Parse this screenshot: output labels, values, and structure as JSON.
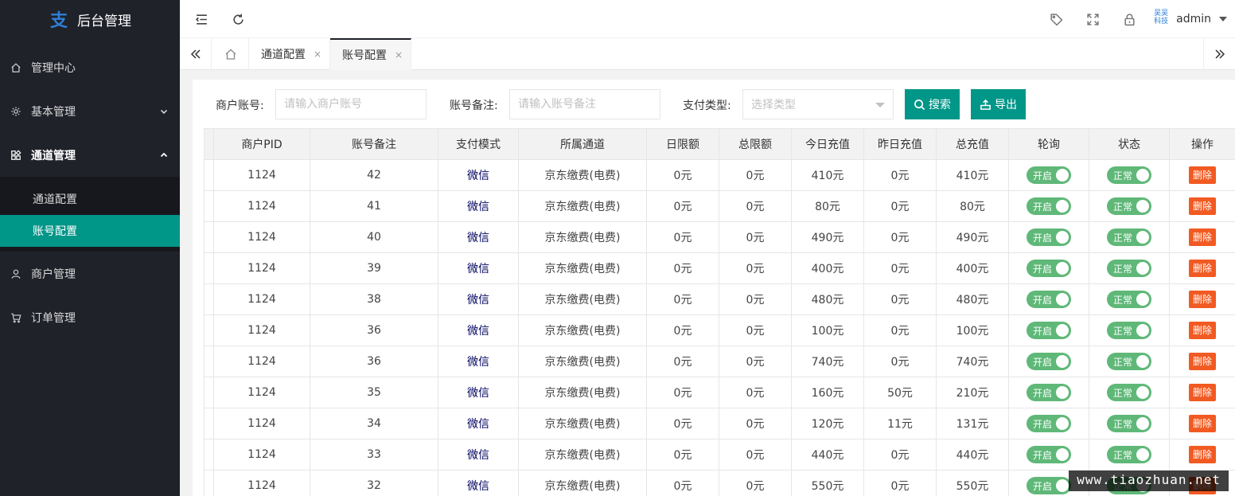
{
  "app": {
    "title": "后台管理"
  },
  "sidebar": {
    "items": [
      {
        "label": "管理中心"
      },
      {
        "label": "基本管理"
      },
      {
        "label": "通道管理"
      },
      {
        "label": "商户管理"
      },
      {
        "label": "订单管理"
      }
    ],
    "sub_items": [
      {
        "label": "通道配置"
      },
      {
        "label": "账号配置"
      }
    ]
  },
  "header": {
    "user": "admin",
    "avatar_text_1": "吴吴",
    "avatar_text_2": "科技"
  },
  "tabs": {
    "t1": "通道配置",
    "t2": "账号配置",
    "close": "×"
  },
  "filters": {
    "merchant_label": "商户账号:",
    "merchant_placeholder": "请输入商户账号",
    "remark_label": "账号备注:",
    "remark_placeholder": "请输入账号备注",
    "paytype_label": "支付类型:",
    "paytype_placeholder": "选择类型",
    "search_label": "搜索",
    "export_label": "导出"
  },
  "table": {
    "headers": [
      "商户PID",
      "账号备注",
      "支付模式",
      "所属通道",
      "日限额",
      "总限额",
      "今日充值",
      "昨日充值",
      "总充值",
      "轮询",
      "状态",
      "操作"
    ],
    "rows": [
      [
        "1124",
        "42",
        "微信",
        "京东缴费(电费)",
        "0元",
        "0元",
        "410元",
        "0元",
        "410元",
        "开启",
        "正常",
        "删除"
      ],
      [
        "1124",
        "41",
        "微信",
        "京东缴费(电费)",
        "0元",
        "0元",
        "80元",
        "0元",
        "80元",
        "开启",
        "正常",
        "删除"
      ],
      [
        "1124",
        "40",
        "微信",
        "京东缴费(电费)",
        "0元",
        "0元",
        "490元",
        "0元",
        "490元",
        "开启",
        "正常",
        "删除"
      ],
      [
        "1124",
        "39",
        "微信",
        "京东缴费(电费)",
        "0元",
        "0元",
        "400元",
        "0元",
        "400元",
        "开启",
        "正常",
        "删除"
      ],
      [
        "1124",
        "38",
        "微信",
        "京东缴费(电费)",
        "0元",
        "0元",
        "480元",
        "0元",
        "480元",
        "开启",
        "正常",
        "删除"
      ],
      [
        "1124",
        "36",
        "微信",
        "京东缴费(电费)",
        "0元",
        "0元",
        "100元",
        "0元",
        "100元",
        "开启",
        "正常",
        "删除"
      ],
      [
        "1124",
        "36",
        "微信",
        "京东缴费(电费)",
        "0元",
        "0元",
        "740元",
        "0元",
        "740元",
        "开启",
        "正常",
        "删除"
      ],
      [
        "1124",
        "35",
        "微信",
        "京东缴费(电费)",
        "0元",
        "0元",
        "160元",
        "50元",
        "210元",
        "开启",
        "正常",
        "删除"
      ],
      [
        "1124",
        "34",
        "微信",
        "京东缴费(电费)",
        "0元",
        "0元",
        "120元",
        "11元",
        "131元",
        "开启",
        "正常",
        "删除"
      ],
      [
        "1124",
        "33",
        "微信",
        "京东缴费(电费)",
        "0元",
        "0元",
        "440元",
        "0元",
        "440元",
        "开启",
        "正常",
        "删除"
      ],
      [
        "1124",
        "32",
        "微信",
        "京东缴费(电费)",
        "0元",
        "0元",
        "550元",
        "0元",
        "550元",
        "开启",
        "正常",
        "删除"
      ]
    ]
  },
  "watermark": "www.tiaozhuan.net",
  "colors": {
    "sidebar_bg": "#20222a",
    "accent": "#009688",
    "switch_on": "#5fb878",
    "danger": "#f15a22",
    "pay_text": "#01025f"
  }
}
